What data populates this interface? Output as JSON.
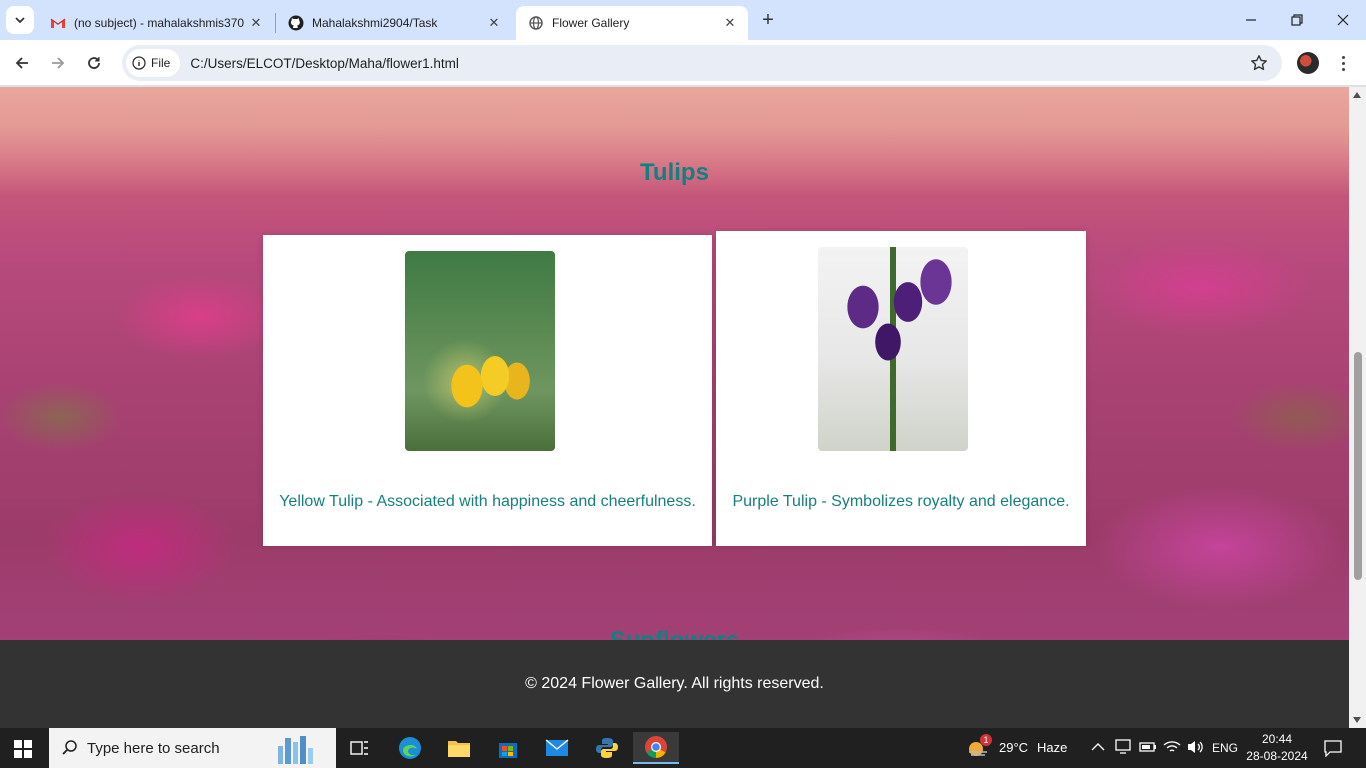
{
  "browser": {
    "tabs": [
      {
        "title": "(no subject) - mahalakshmis370",
        "icon": "gmail-icon"
      },
      {
        "title": "Mahalakshmi2904/Task",
        "icon": "github-icon"
      },
      {
        "title": "Flower Gallery",
        "icon": "globe-icon",
        "active": true
      }
    ],
    "address": {
      "chip_label": "File",
      "url": "C:/Users/ELCOT/Desktop/Maha/flower1.html"
    }
  },
  "page": {
    "section_title": "Tulips",
    "next_section_title": "Sunflowers",
    "cards": [
      {
        "caption": "Yellow Tulip - Associated with happiness and cheerfulness.",
        "image": "yellow-tulip"
      },
      {
        "caption": "Purple Tulip - Symbolizes royalty and elegance.",
        "image": "purple-tulip"
      }
    ],
    "footer_text": "© 2024 Flower Gallery. All rights reserved."
  },
  "taskbar": {
    "search_placeholder": "Type here to search",
    "weather": {
      "temp": "29°C",
      "condition": "Haze",
      "badge": "1"
    },
    "language": "ENG",
    "time": "20:44",
    "date": "28-08-2024"
  },
  "colors": {
    "accent_text": "#128080",
    "footer_bg": "#333333",
    "tab_strip": "#d3e3fd"
  }
}
